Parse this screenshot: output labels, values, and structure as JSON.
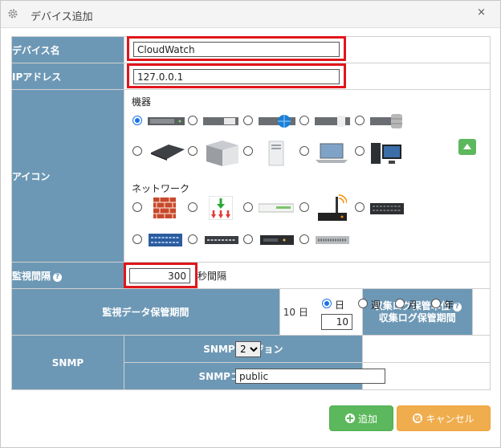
{
  "dialog": {
    "title": "デバイス追加",
    "close": "×"
  },
  "fields": {
    "device_name": {
      "label": "デバイス名",
      "value": "CloudWatch"
    },
    "ip": {
      "label": "IPアドレス",
      "value": "127.0.0.1"
    },
    "icon": {
      "label": "アイコン",
      "equipment_label": "機器",
      "network_label": "ネットワーク"
    },
    "interval": {
      "label": "監視間隔",
      "value": "300",
      "unit": "秒間隔"
    },
    "retention": {
      "label": "監視データ保管期間",
      "value": "10 日"
    },
    "log_unit": {
      "label1": "収集ログ保管単位",
      "label2": "収集ログ保管期間",
      "options": [
        "日",
        "週",
        "月",
        "年"
      ],
      "selected": "日",
      "period": "10"
    },
    "snmp": {
      "label": "SNMP",
      "version_label": "SNMPバージョン",
      "version": "2",
      "community_label": "SNMPコミュニティ",
      "community": "public"
    }
  },
  "icons": {
    "equipment": [
      "rack-server-icon",
      "rack-server-white-icon",
      "rack-server-globe-icon",
      "rack-server-disk-icon",
      "rack-storage-icon",
      "appliance-icon",
      "tower-server-icon",
      "white-tower-icon",
      "laptop-icon",
      "desktop-pc-icon"
    ],
    "network": [
      "firewall-icon",
      "switch-arrows-icon",
      "hub-icon",
      "wireless-router-icon",
      "switch-black-icon",
      "switch-blue-icon",
      "switch-dark-icon",
      "switch-flat-icon",
      "patch-panel-icon"
    ]
  },
  "buttons": {
    "add": "追加",
    "cancel": "キャンセル"
  },
  "colors": {
    "header_bg": "#6d98b5",
    "highlight": "#e0161b",
    "add": "#5cb85c",
    "cancel": "#f0ad4e"
  }
}
